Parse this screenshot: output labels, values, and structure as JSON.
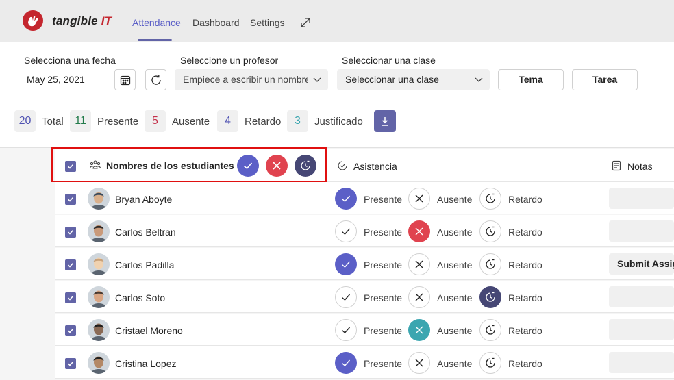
{
  "app": {
    "brand_name": "tangible",
    "brand_suffix": "IT",
    "tabs": [
      {
        "label": "Attendance",
        "active": true
      },
      {
        "label": "Dashboard",
        "active": false
      },
      {
        "label": "Settings",
        "active": false
      }
    ],
    "accent_color": "#6264a7",
    "brand_red": "#c4262e"
  },
  "filters": {
    "date_label": "Selecciona una fecha",
    "date_value": "May 25, 2021",
    "teacher_label": "Seleccione un profesor",
    "teacher_placeholder": "Empiece a escribir un nombre",
    "class_label": "Seleccionar una clase",
    "class_value": "Seleccionar una clase",
    "topic_button": "Tema",
    "task_button": "Tarea"
  },
  "stats": [
    {
      "value": "20",
      "label": "Total",
      "color": "#4f52b2"
    },
    {
      "value": "11",
      "label": "Presente",
      "color": "#237b4b"
    },
    {
      "value": "5",
      "label": "Ausente",
      "color": "#c4314b"
    },
    {
      "value": "4",
      "label": "Retardo",
      "color": "#4f52b2"
    },
    {
      "value": "3",
      "label": "Justificado",
      "color": "#3ba6b0"
    }
  ],
  "table": {
    "header": {
      "names": "Nombres de los estudiantes",
      "attendance": "Asistencia",
      "notes": "Notas"
    },
    "option_labels": {
      "present": "Presente",
      "absent": "Ausente",
      "late": "Retardo"
    },
    "rows": [
      {
        "name": "Bryan Aboyte",
        "status": "present",
        "note": ""
      },
      {
        "name": "Carlos Beltran",
        "status": "absent",
        "note": ""
      },
      {
        "name": "Carlos Padilla",
        "status": "present",
        "note": "Submit Assignment"
      },
      {
        "name": "Carlos Soto",
        "status": "late",
        "note": ""
      },
      {
        "name": "Cristael Moreno",
        "status": "justified",
        "note": ""
      },
      {
        "name": "Cristina Lopez",
        "status": "present",
        "note": ""
      }
    ]
  },
  "status_colors": {
    "present": "#5b5fc7",
    "absent": "#e0434f",
    "late": "#464775",
    "justified": "#3ba6b0"
  }
}
